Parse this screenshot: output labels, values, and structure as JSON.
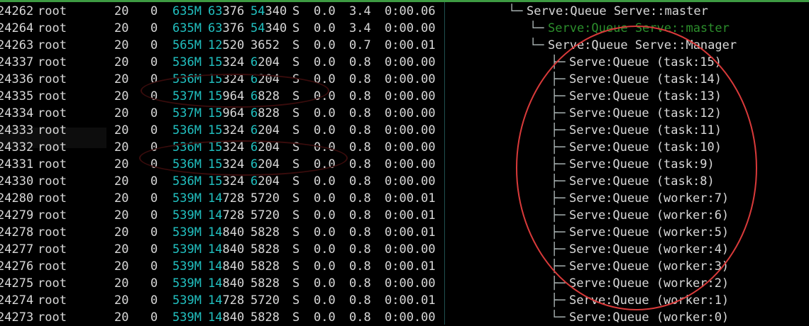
{
  "columns_visible": [
    "pid",
    "user",
    "pri",
    "ni",
    "virt",
    "res",
    "shr",
    "state",
    "cpu",
    "mem",
    "time",
    "command"
  ],
  "colors": {
    "accent_cyan": "#21c0c0",
    "tree_green": "#2c8f2c",
    "annotation_red": "#d93a3a",
    "top_bar": "#3d9a42"
  },
  "processes": [
    {
      "pid": "24262",
      "user": "root",
      "pri": "20",
      "ni": "0",
      "virt": "635M",
      "res_hi": "63",
      "res_lo": "376",
      "shr_hi": "54",
      "shr_lo": "340",
      "state": "S",
      "cpu": "0.0",
      "mem": "3.4",
      "time": "0:00.06",
      "tree": "└─ ",
      "command": "Serve:Queue Serve::master",
      "cmd_style": "main"
    },
    {
      "pid": "24264",
      "user": "root",
      "pri": "20",
      "ni": "0",
      "virt": "635M",
      "res_hi": "63",
      "res_lo": "376",
      "shr_hi": "54",
      "shr_lo": "340",
      "state": "S",
      "cpu": "0.0",
      "mem": "3.4",
      "time": "0:00.00",
      "tree": "└─ ",
      "command": "Serve:Queue Serve::master",
      "cmd_style": "dim"
    },
    {
      "pid": "24263",
      "user": "root",
      "pri": "20",
      "ni": "0",
      "virt": "565M",
      "res_hi": "12",
      "res_lo": "520",
      "shr_hi": "",
      "shr_lo": "3652",
      "state": "S",
      "cpu": "0.0",
      "mem": "0.7",
      "time": "0:00.01",
      "tree": "└─ ",
      "command": "Serve:Queue Serve::Manager",
      "cmd_style": "main"
    },
    {
      "pid": "24337",
      "user": "root",
      "pri": "20",
      "ni": "0",
      "virt": "536M",
      "res_hi": "15",
      "res_lo": "324",
      "shr_hi": "6",
      "shr_lo": "204",
      "state": "S",
      "cpu": "0.0",
      "mem": "0.8",
      "time": "0:00.00",
      "tree": "├─ ",
      "command": "Serve:Queue (task:15)",
      "cmd_style": "main"
    },
    {
      "pid": "24336",
      "user": "root",
      "pri": "20",
      "ni": "0",
      "virt": "536M",
      "res_hi": "15",
      "res_lo": "324",
      "shr_hi": "6",
      "shr_lo": "204",
      "state": "S",
      "cpu": "0.0",
      "mem": "0.8",
      "time": "0:00.00",
      "tree": "├─ ",
      "command": "Serve:Queue (task:14)",
      "cmd_style": "main"
    },
    {
      "pid": "24335",
      "user": "root",
      "pri": "20",
      "ni": "0",
      "virt": "537M",
      "res_hi": "15",
      "res_lo": "964",
      "shr_hi": "6",
      "shr_lo": "828",
      "state": "S",
      "cpu": "0.0",
      "mem": "0.8",
      "time": "0:00.00",
      "tree": "├─ ",
      "command": "Serve:Queue (task:13)",
      "cmd_style": "main"
    },
    {
      "pid": "24334",
      "user": "root",
      "pri": "20",
      "ni": "0",
      "virt": "537M",
      "res_hi": "15",
      "res_lo": "964",
      "shr_hi": "6",
      "shr_lo": "828",
      "state": "S",
      "cpu": "0.0",
      "mem": "0.8",
      "time": "0:00.00",
      "tree": "├─ ",
      "command": "Serve:Queue (task:12)",
      "cmd_style": "main"
    },
    {
      "pid": "24333",
      "user": "root",
      "pri": "20",
      "ni": "0",
      "virt": "536M",
      "res_hi": "15",
      "res_lo": "324",
      "shr_hi": "6",
      "shr_lo": "204",
      "state": "S",
      "cpu": "0.0",
      "mem": "0.8",
      "time": "0:00.00",
      "tree": "├─ ",
      "command": "Serve:Queue (task:11)",
      "cmd_style": "main"
    },
    {
      "pid": "24332",
      "user": "root",
      "pri": "20",
      "ni": "0",
      "virt": "536M",
      "res_hi": "15",
      "res_lo": "324",
      "shr_hi": "6",
      "shr_lo": "204",
      "state": "S",
      "cpu": "0.0",
      "mem": "0.8",
      "time": "0:00.00",
      "tree": "├─ ",
      "command": "Serve:Queue (task:10)",
      "cmd_style": "main"
    },
    {
      "pid": "24331",
      "user": "root",
      "pri": "20",
      "ni": "0",
      "virt": "536M",
      "res_hi": "15",
      "res_lo": "324",
      "shr_hi": "6",
      "shr_lo": "204",
      "state": "S",
      "cpu": "0.0",
      "mem": "0.8",
      "time": "0:00.00",
      "tree": "├─ ",
      "command": "Serve:Queue (task:9)",
      "cmd_style": "main"
    },
    {
      "pid": "24330",
      "user": "root",
      "pri": "20",
      "ni": "0",
      "virt": "536M",
      "res_hi": "15",
      "res_lo": "324",
      "shr_hi": "6",
      "shr_lo": "204",
      "state": "S",
      "cpu": "0.0",
      "mem": "0.8",
      "time": "0:00.00",
      "tree": "├─ ",
      "command": "Serve:Queue (task:8)",
      "cmd_style": "main"
    },
    {
      "pid": "24280",
      "user": "root",
      "pri": "20",
      "ni": "0",
      "virt": "539M",
      "res_hi": "14",
      "res_lo": "728",
      "shr_hi": "",
      "shr_lo": "5720",
      "state": "S",
      "cpu": "0.0",
      "mem": "0.8",
      "time": "0:00.01",
      "tree": "├─ ",
      "command": "Serve:Queue (worker:7)",
      "cmd_style": "main"
    },
    {
      "pid": "24279",
      "user": "root",
      "pri": "20",
      "ni": "0",
      "virt": "539M",
      "res_hi": "14",
      "res_lo": "728",
      "shr_hi": "",
      "shr_lo": "5720",
      "state": "S",
      "cpu": "0.0",
      "mem": "0.8",
      "time": "0:00.01",
      "tree": "├─ ",
      "command": "Serve:Queue (worker:6)",
      "cmd_style": "main"
    },
    {
      "pid": "24278",
      "user": "root",
      "pri": "20",
      "ni": "0",
      "virt": "539M",
      "res_hi": "14",
      "res_lo": "840",
      "shr_hi": "",
      "shr_lo": "5828",
      "state": "S",
      "cpu": "0.0",
      "mem": "0.8",
      "time": "0:00.01",
      "tree": "├─ ",
      "command": "Serve:Queue (worker:5)",
      "cmd_style": "main"
    },
    {
      "pid": "24277",
      "user": "root",
      "pri": "20",
      "ni": "0",
      "virt": "539M",
      "res_hi": "14",
      "res_lo": "840",
      "shr_hi": "",
      "shr_lo": "5828",
      "state": "S",
      "cpu": "0.0",
      "mem": "0.8",
      "time": "0:00.00",
      "tree": "├─ ",
      "command": "Serve:Queue (worker:4)",
      "cmd_style": "main"
    },
    {
      "pid": "24276",
      "user": "root",
      "pri": "20",
      "ni": "0",
      "virt": "539M",
      "res_hi": "14",
      "res_lo": "840",
      "shr_hi": "",
      "shr_lo": "5828",
      "state": "S",
      "cpu": "0.0",
      "mem": "0.8",
      "time": "0:00.01",
      "tree": "├─ ",
      "command": "Serve:Queue (worker:3)",
      "cmd_style": "main"
    },
    {
      "pid": "24275",
      "user": "root",
      "pri": "20",
      "ni": "0",
      "virt": "539M",
      "res_hi": "14",
      "res_lo": "840",
      "shr_hi": "",
      "shr_lo": "5828",
      "state": "S",
      "cpu": "0.0",
      "mem": "0.8",
      "time": "0:00.00",
      "tree": "├─ ",
      "command": "Serve:Queue (worker:2)",
      "cmd_style": "main"
    },
    {
      "pid": "24274",
      "user": "root",
      "pri": "20",
      "ni": "0",
      "virt": "539M",
      "res_hi": "14",
      "res_lo": "728",
      "shr_hi": "",
      "shr_lo": "5720",
      "state": "S",
      "cpu": "0.0",
      "mem": "0.8",
      "time": "0:00.01",
      "tree": "├─ ",
      "command": "Serve:Queue (worker:1)",
      "cmd_style": "main"
    },
    {
      "pid": "24273",
      "user": "root",
      "pri": "20",
      "ni": "0",
      "virt": "539M",
      "res_hi": "14",
      "res_lo": "840",
      "shr_hi": "",
      "shr_lo": "5828",
      "state": "S",
      "cpu": "0.0",
      "mem": "0.8",
      "time": "0:00.00",
      "tree": "└─ ",
      "command": "Serve:Queue (worker:0)",
      "cmd_style": "main"
    }
  ]
}
